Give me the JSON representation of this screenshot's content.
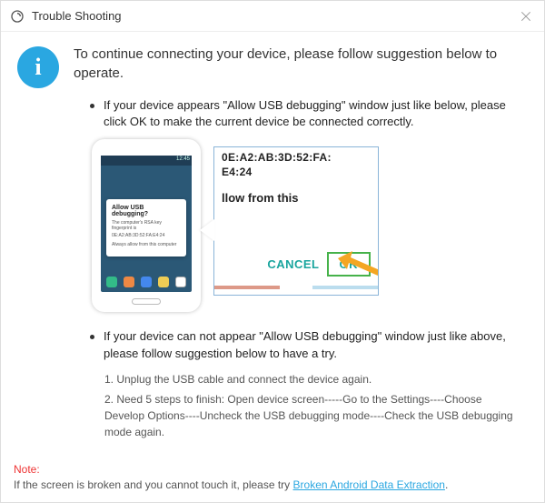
{
  "titlebar": {
    "title": "Trouble Shooting"
  },
  "intro": "To continue connecting your device, please follow suggestion below to operate.",
  "bullet1": "If your device appears \"Allow USB debugging\" window just like below, please click OK to make the current device  be connected correctly.",
  "bullet2": "If your device can not appear \"Allow USB debugging\" window just like above, please follow suggestion below to have a try.",
  "steps": {
    "s1": "1. Unplug the USB cable and connect the device again.",
    "s2": "2. Need 5 steps to finish: Open device screen-----Go to the Settings----Choose Develop Options----Uncheck the USB debugging mode----Check the USB debugging mode again."
  },
  "phone": {
    "dialog_title": "Allow USB debugging?",
    "line1": "The computer's RSA key fingerprint is",
    "line2": "0E:A2:AB:3D:52:FA:E4:24",
    "line3": "Always allow from this computer"
  },
  "zoom": {
    "mac1": "0E:A2:AB:3D:52:FA:",
    "mac2": "E4:24",
    "text": "llow from this",
    "cancel": "CANCEL",
    "ok": "OK"
  },
  "note": {
    "label": "Note:",
    "text": "If the screen is broken and you cannot touch it, please try ",
    "link": "Broken Android Data Extraction",
    "tail": "."
  }
}
